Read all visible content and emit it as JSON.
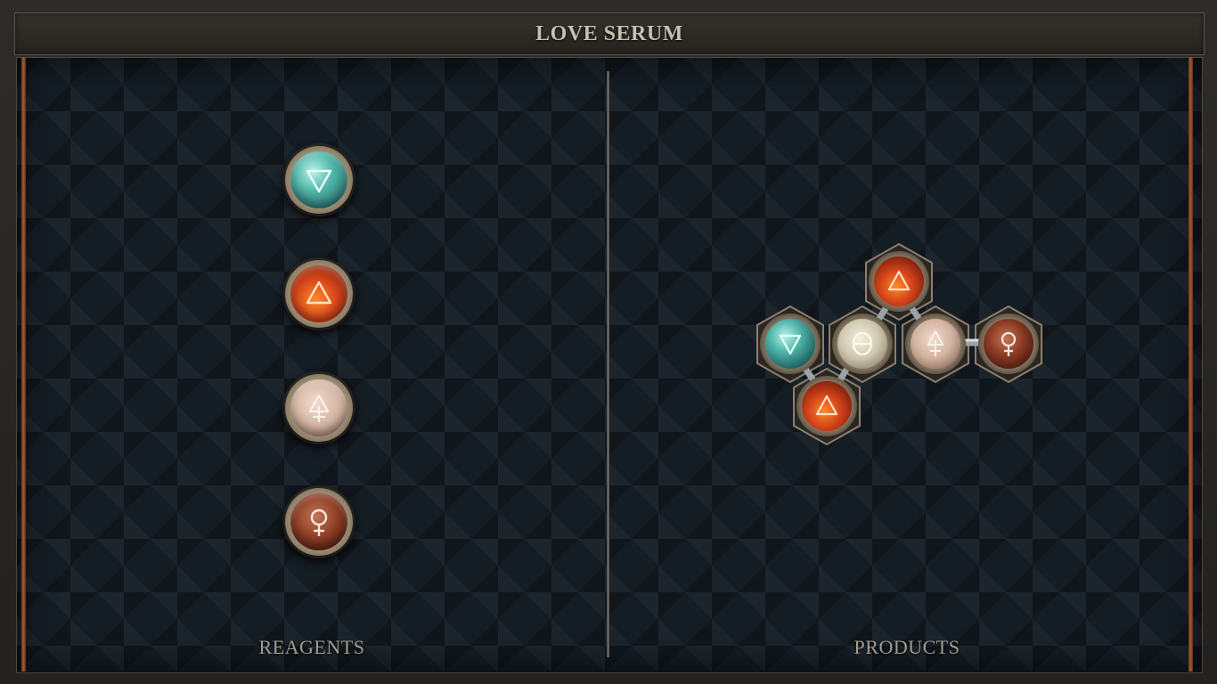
{
  "title": "LOVE SERUM",
  "reagents_label": "REAGENTS",
  "products_label": "PRODUCTS",
  "reagents": [
    {
      "element": "water",
      "icon": "water-triangle-icon"
    },
    {
      "element": "fire",
      "icon": "fire-triangle-icon"
    },
    {
      "element": "salt-earth",
      "icon": "earth-symbol-icon"
    },
    {
      "element": "copper",
      "icon": "venus-copper-icon"
    }
  ],
  "product_atoms": [
    {
      "element": "fire",
      "icon": "fire-triangle-icon"
    },
    {
      "element": "water",
      "icon": "water-triangle-icon"
    },
    {
      "element": "neutral",
      "icon": "theta-symbol-icon"
    },
    {
      "element": "salt-earth",
      "icon": "earth-symbol-icon"
    },
    {
      "element": "copper",
      "icon": "venus-copper-icon"
    },
    {
      "element": "fire",
      "icon": "fire-triangle-icon"
    }
  ],
  "colors": {
    "water": "#4fb4a8",
    "fire": "#d5451a",
    "salt": "#d2b2a0",
    "copper": "#8a3a24",
    "neutral": "#cfc8b0",
    "frame": "#2e2b28",
    "board": "#141c24"
  }
}
